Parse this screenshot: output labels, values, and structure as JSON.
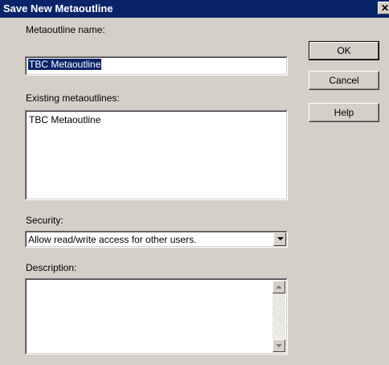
{
  "window": {
    "title": "Save New Metaoutline",
    "close_glyph": "✕"
  },
  "form": {
    "name_label": "Metaoutline name:",
    "name_value": "TBC Metaoutline",
    "existing_label": "Existing metaoutlines:",
    "existing_items": [
      "TBC Metaoutline"
    ],
    "security_label": "Security:",
    "security_selected": "Allow read/write access for other users.",
    "description_label": "Description:",
    "description_value": ""
  },
  "buttons": {
    "ok": "OK",
    "cancel": "Cancel",
    "help": "Help"
  },
  "colors": {
    "titlebar": "#0a246a",
    "face": "#d4d0c8",
    "selection": "#0a246a"
  },
  "icons": {
    "close": "close-icon",
    "dropdown": "chevron-down-icon",
    "scroll_up": "arrow-up-icon",
    "scroll_down": "arrow-down-icon"
  }
}
